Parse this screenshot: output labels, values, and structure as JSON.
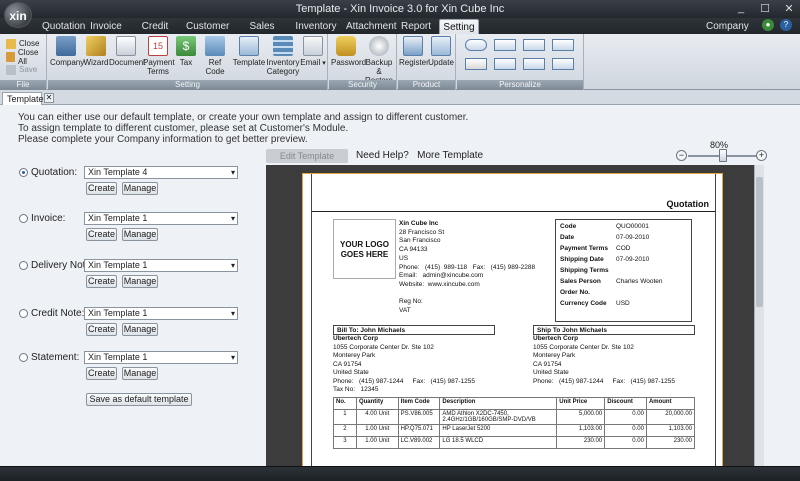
{
  "window": {
    "title": "Template - Xin Invoice 3.0 for Xin Cube Inc",
    "logo_text": "xin",
    "controls": [
      "_",
      "☐",
      "✕"
    ]
  },
  "menu": {
    "tabs": [
      "Quotation",
      "Invoice",
      "Credit Note",
      "Customer",
      "Sales Person",
      "Inventory",
      "Attachment",
      "Report",
      "Setting"
    ],
    "active": "Setting",
    "right": "Company"
  },
  "ribbon": {
    "file": {
      "label": "File",
      "items": [
        "Close",
        "Close All",
        "Save"
      ]
    },
    "setting": {
      "label": "Setting",
      "buttons": [
        "Company",
        "Wizard",
        "Document",
        "Payment Terms",
        "Tax",
        "Ref Code",
        "Template",
        "Inventory Category",
        "Email"
      ]
    },
    "security": {
      "label": "Security",
      "buttons": [
        "Password",
        "Backup & Restore"
      ]
    },
    "product": {
      "label": "Product",
      "buttons": [
        "Register",
        "Update"
      ]
    },
    "personalize": {
      "label": "Personalize"
    }
  },
  "doc_tab": {
    "label": "Template",
    "close": "✕"
  },
  "info": [
    "You can either use our default template, or create your own template and assign to different customer.",
    "To assign template to different customer, please set at Customer's Module.",
    "Please complete your Company information to get better preview."
  ],
  "buttons": {
    "create": "Create",
    "manage": "Manage",
    "save_default": "Save as default template"
  },
  "template_rows": [
    {
      "label": "Quotation:",
      "value": "Xin Template 4",
      "selected": true
    },
    {
      "label": "Invoice:",
      "value": "Xin Template 1",
      "selected": false
    },
    {
      "label": "Delivery Note:",
      "value": "Xin Template 1",
      "selected": false
    },
    {
      "label": "Credit Note:",
      "value": "Xin Template 1",
      "selected": false
    },
    {
      "label": "Statement:",
      "value": "Xin Template 1",
      "selected": false
    }
  ],
  "toolbar": {
    "edit_template": "Edit Template",
    "need_help": "Need Help?",
    "more_template": "More Template"
  },
  "zoom": {
    "level": "80%",
    "fraction": 0.5
  },
  "preview": {
    "doc_title": "Quotation",
    "logo_text": "YOUR LOGO GOES HERE",
    "company": {
      "name": "Xin Cube Inc",
      "lines": [
        "28 Francisco St",
        "San Francisco",
        "CA 94133",
        "US",
        "Phone:   (415)  989-118   Fax:   (415) 989-2288",
        "Email:   admin@xincube.com",
        "Website:  www.xincube.com",
        "",
        "Reg No:",
        "VAT"
      ]
    },
    "meta": [
      {
        "k": "Code",
        "v": "QUO00001"
      },
      {
        "k": "Date",
        "v": "07-09-2010"
      },
      {
        "k": "Payment Terms",
        "v": "COD"
      },
      {
        "k": "Shipping Date",
        "v": "07-09-2010"
      },
      {
        "k": "Shipping Terms",
        "v": ""
      },
      {
        "k": "Sales Person",
        "v": "Charles Wooten"
      },
      {
        "k": "Order No.",
        "v": ""
      },
      {
        "k": "Currency Code",
        "v": "USD"
      }
    ],
    "bill_to": {
      "head": "Bill To:  John Michaels",
      "lines": [
        "Ubertech Corp",
        "1055 Corporate Center Dr. Ste 102",
        "Monterey Park",
        "CA 91754",
        "United State",
        "Phone:   (415) 987-1244     Fax:   (415) 987-1255",
        "Tax No:   12345"
      ]
    },
    "ship_to": {
      "head": "Ship To  John Michaels",
      "lines": [
        "Ubertech Corp",
        "1055 Corporate Center Dr. Ste 102",
        "Monterey Park",
        "CA 91754",
        "United State",
        "Phone:   (415) 987-1244     Fax:   (415) 987-1255"
      ]
    },
    "table": {
      "headers": [
        "No.",
        "Quantity",
        "Item Code",
        "Description",
        "Unit Price",
        "Discount",
        "Amount"
      ],
      "rows": [
        [
          "1",
          "4.00 Unit",
          "PS.V86.005",
          "AMD Athlon X2DC-7450, 2.4GHz/1GB/160GB/SMP-DVD/VB",
          "5,000.00",
          "0.00",
          "20,000.00"
        ],
        [
          "2",
          "1.00 Unit",
          "HP.Q75.071",
          "HP LaserJet 5200",
          "1,103.00",
          "0.00",
          "1,103.00"
        ],
        [
          "3",
          "1.00 Unit",
          "LC.V89.002",
          "LG 18.5 WLCD",
          "230.00",
          "0.00",
          "230.00"
        ]
      ]
    }
  },
  "colors": {
    "accent": "#2a5fa0",
    "frame": "#23282e",
    "page_border": "#e2a43c"
  }
}
